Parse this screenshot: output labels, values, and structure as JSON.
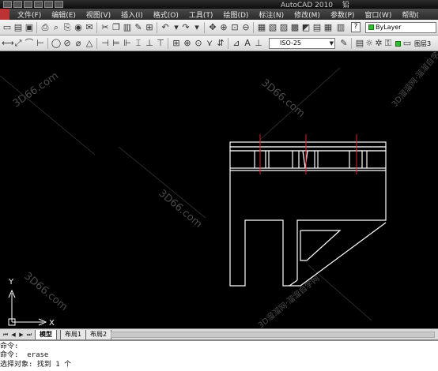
{
  "title_bar": {
    "app": "AutoCAD 2010",
    "doc": "铅"
  },
  "menu": [
    "文件(F)",
    "编辑(E)",
    "视图(V)",
    "插入(I)",
    "格式(O)",
    "工具(T)",
    "绘图(D)",
    "标注(N)",
    "修改(M)",
    "参数(P)",
    "窗口(W)",
    "帮助("
  ],
  "toolbar": {
    "layer_value": "ByLayer",
    "dimstyle_value": "ISO-25",
    "layer_name": "图层3",
    "help_label": "?"
  },
  "ucs": {
    "x_label": "X",
    "y_label": "Y"
  },
  "layout_tabs": [
    "模型",
    "布局1",
    "布局2"
  ],
  "command_lines": [
    "命令:",
    "命令:  erase",
    "选择对象: 找到 1 个"
  ],
  "watermarks": [
    "3D66.com",
    "3D溜溜网·溜溜自学网"
  ],
  "colors": {
    "canvas": "#000000",
    "geometry": "#ffffff",
    "centerline": "#e0202a",
    "watermark": "#555555"
  }
}
